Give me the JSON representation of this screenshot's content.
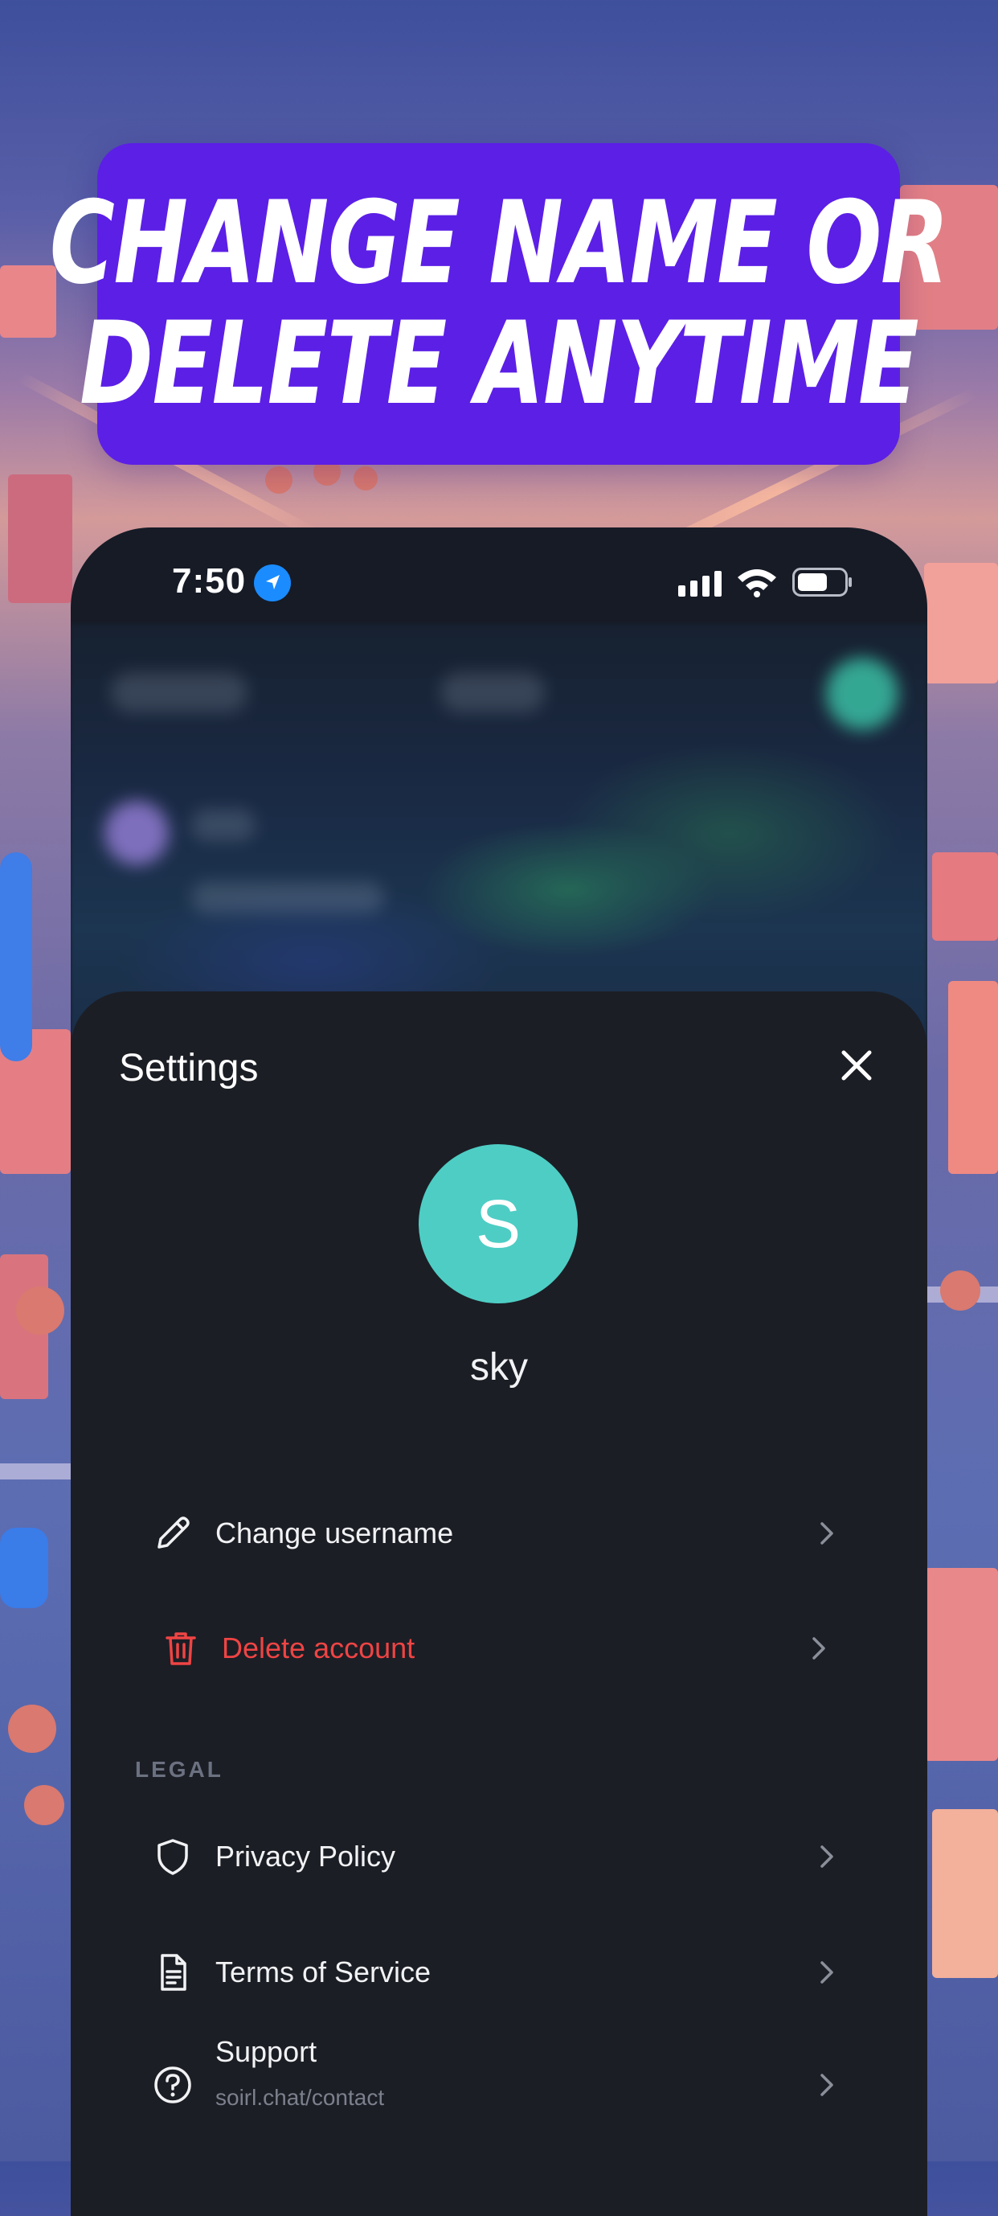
{
  "banner": {
    "line1": "CHANGE NAME OR",
    "line2": "DELETE ANYTIME"
  },
  "status_bar": {
    "time": "7:50",
    "icons": [
      "location-arrow-icon",
      "signal-icon",
      "wifi-icon",
      "battery-icon"
    ]
  },
  "settings": {
    "title": "Settings",
    "close_icon": "close-icon",
    "avatar_initial": "S",
    "avatar_color": "#4ecdc4",
    "username": "sky",
    "account_items": [
      {
        "label": "Change username",
        "icon": "pencil-icon"
      },
      {
        "label": "Delete account",
        "icon": "trash-icon",
        "color": "#ef4444"
      }
    ],
    "legal_section_label": "LEGAL",
    "legal_items": [
      {
        "label": "Privacy Policy",
        "icon": "shield-icon"
      },
      {
        "label": "Terms of Service",
        "icon": "document-icon"
      },
      {
        "label": "Support",
        "sublabel": "soirl.chat/contact",
        "icon": "help-circle-icon"
      }
    ]
  },
  "colors": {
    "banner": "#5c1fe6",
    "sheet_background": "#1c1e25",
    "danger": "#ef4444",
    "location_badge": "#1a8cff"
  }
}
